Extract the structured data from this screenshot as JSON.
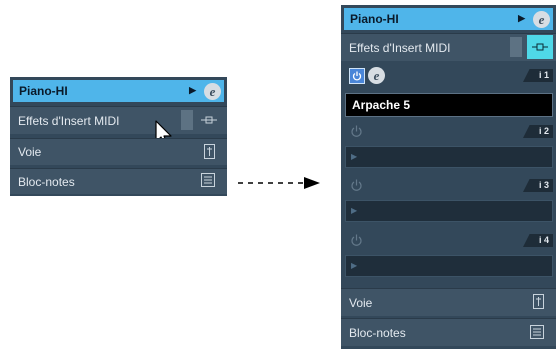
{
  "left_panel": {
    "title": "Piano-HI",
    "rows": [
      {
        "label": "Effets d'Insert MIDI"
      },
      {
        "label": "Voie"
      },
      {
        "label": "Bloc-notes"
      }
    ]
  },
  "right_panel": {
    "title": "Piano-HI",
    "insert_label": "Effets d'Insert MIDI",
    "slots": [
      {
        "number": "i 1",
        "effect": "Arpache 5"
      },
      {
        "number": "i 2",
        "effect": ""
      },
      {
        "number": "i 3",
        "effect": ""
      },
      {
        "number": "i 4",
        "effect": ""
      }
    ],
    "rows": [
      {
        "label": "Voie"
      },
      {
        "label": "Bloc-notes"
      }
    ]
  },
  "colors": {
    "panel_bg": "#33485a",
    "title_bg": "#4fb5ea",
    "accent_teal": "#4fd8e8"
  },
  "icons": [
    "e-icon",
    "triangle-right-icon",
    "insert-plug-icon",
    "channel-icon",
    "notepad-icon",
    "power-icon",
    "mouse-cursor-icon",
    "arrow-icon"
  ]
}
